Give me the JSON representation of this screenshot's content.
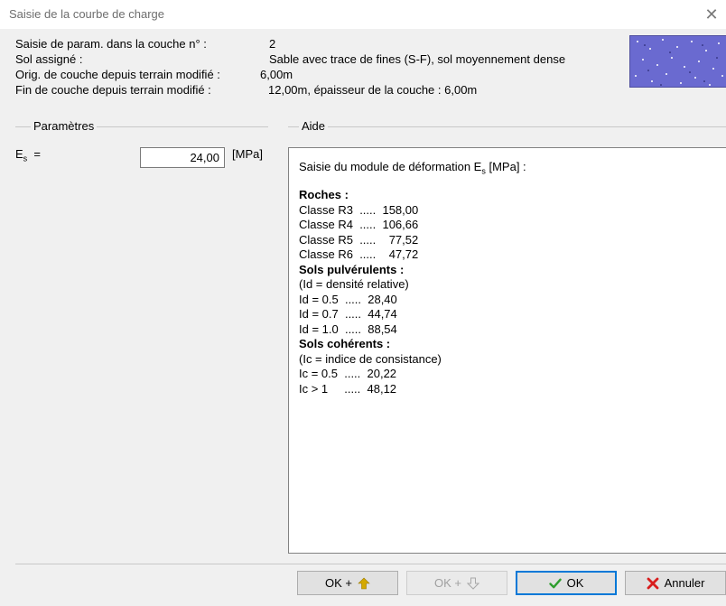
{
  "window": {
    "title": "Saisie de la courbe de charge",
    "close_glyph": "✕"
  },
  "info": {
    "layer_label": "Saisie de param. dans la couche n° :",
    "layer_value": "2",
    "soil_label": "Sol assigné :",
    "soil_value": "Sable avec trace de fines (S-F), sol moyennement dense",
    "origin_label": "Orig. de couche depuis terrain modifié :",
    "origin_value": "6,00m",
    "end_label": "Fin de couche depuis terrain modifié :",
    "end_value": "12,00m, épaisseur de la couche : 6,00m",
    "swatch_color": "#6a6ad0"
  },
  "params": {
    "group_label": "Paramètres",
    "es_symbol": "E",
    "es_sub": "s",
    "es_eq": "=",
    "es_value": "24,00",
    "es_unit": "[MPa]"
  },
  "help": {
    "group_label": "Aide",
    "intro_pre": "Saisie du module de déformation E",
    "intro_sub": "s",
    "intro_post": " [MPa] :",
    "lines": [
      {
        "text": "Roches :",
        "bold": true
      },
      {
        "text": "Classe R3  .....  158,00",
        "bold": false
      },
      {
        "text": "Classe R4  .....  106,66",
        "bold": false
      },
      {
        "text": "Classe R5  .....    77,52",
        "bold": false
      },
      {
        "text": "Classe R6  .....    47,72",
        "bold": false
      },
      {
        "text": "Sols pulvérulents :",
        "bold": true
      },
      {
        "text": "(Id = densité relative)",
        "bold": false
      },
      {
        "text": "Id = 0.5  .....  28,40",
        "bold": false
      },
      {
        "text": "Id = 0.7  .....  44,74",
        "bold": false
      },
      {
        "text": "Id = 1.0  .....  88,54",
        "bold": false
      },
      {
        "text": "Sols cohérents :",
        "bold": true
      },
      {
        "text": "(Ic = indice de consistance)",
        "bold": false
      },
      {
        "text": "Ic = 0.5  .....  20,22",
        "bold": false
      },
      {
        "text": "Ic > 1     .....  48,12",
        "bold": false
      }
    ]
  },
  "buttons": {
    "ok_up": "OK +",
    "ok_down": "OK +",
    "ok": "OK",
    "cancel": "Annuler"
  },
  "colors": {
    "arrow_up": "#d4a900",
    "check": "#2e9e2e",
    "cancel_x": "#d81e1e",
    "default_border": "#0078d7"
  }
}
